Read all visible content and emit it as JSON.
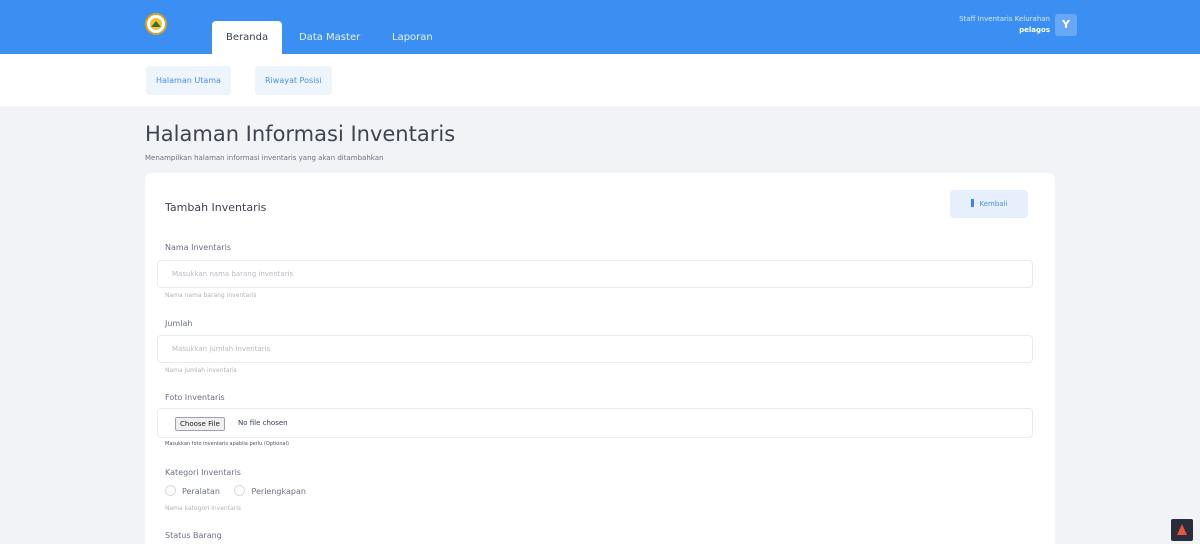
{
  "nav": {
    "tabs": [
      {
        "label": "Beranda",
        "active": true
      },
      {
        "label": "Data Master",
        "active": false
      },
      {
        "label": "Laporan",
        "active": false
      }
    ],
    "user": {
      "role": "Staff Inventaris Kelurahan",
      "name": "pelagos",
      "avatar_letter": "Y"
    }
  },
  "subnav": {
    "items": [
      {
        "label": "Halaman Utama"
      },
      {
        "label": "Riwayat Posisi"
      }
    ]
  },
  "page": {
    "title": "Halaman Informasi Inventaris",
    "subtitle": "Menampilkan halaman informasi inventaris yang akan ditambahkan"
  },
  "card": {
    "title": "Tambah Inventaris",
    "back_button": "Kembali"
  },
  "form": {
    "nama": {
      "label": "Nama Inventaris",
      "placeholder": "Masukkan nama barang inventaris",
      "help": "Nama nama barang inventaris"
    },
    "jumlah": {
      "label": "Jumlah",
      "placeholder": "Masukkan jumlah inventaris",
      "help": "Nama jumlah inventaris"
    },
    "foto": {
      "label": "Foto Inventaris",
      "button": "Choose File",
      "status": "No file chosen",
      "help": "Masukkan foto inventaris apabila perlu (Optional)"
    },
    "kategori": {
      "label": "Kategori Inventaris",
      "options": [
        "Peralatan",
        "Perlengkapan"
      ],
      "help": "Nama kategori inventaris"
    },
    "status": {
      "label": "Status Barang"
    }
  },
  "colors": {
    "topbar": "#3b8ff3",
    "accent": "#4a8fe0",
    "background": "#f1f3f7"
  }
}
